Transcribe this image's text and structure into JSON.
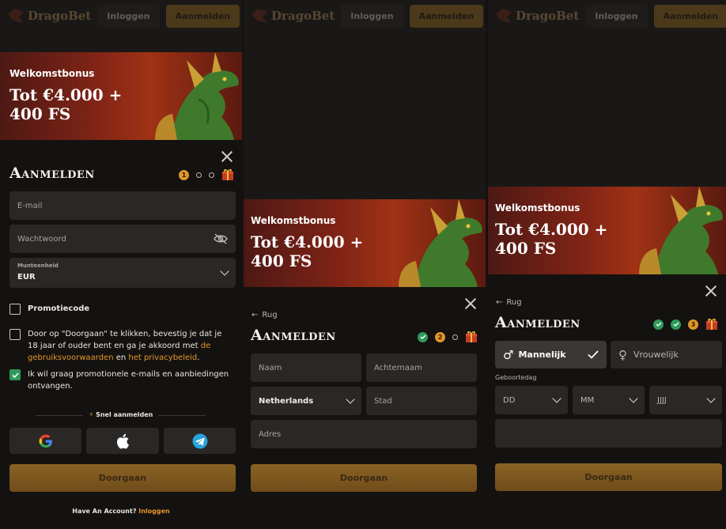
{
  "brand": {
    "logo_text": "DragoBet"
  },
  "topbar": {
    "login_label": "Inloggen",
    "signup_label": "Aanmelden"
  },
  "banner": {
    "subtitle": "Welkomstbonus",
    "headline_line1": "Tot €4.000 +",
    "headline_line2": "400 FS"
  },
  "form_title": "Aanmelden",
  "back_label": "Rug",
  "step1": {
    "current_step": "1",
    "email_placeholder": "E-mail",
    "password_placeholder": "Wachtwoord",
    "currency_label": "Munteenheid",
    "currency_value": "EUR",
    "promo_label": "Promotiecode",
    "terms_text_1": "Door op \"Doorgaan\" te klikken, bevestig je dat je 18 jaar of ouder bent en ga je akkoord met ",
    "terms_link_1": "de gebruiksvoorwaarden",
    "terms_text_2": " en ",
    "terms_link_2": "het privacybeleid",
    "terms_text_3": ".",
    "marketing_label": "Ik wil graag promotionele e-mails en aanbiedingen ontvangen.",
    "quick_signup_label": "Snel aanmelden",
    "continue_label": "Doorgaan",
    "footer_text": "Have An Account?",
    "footer_link": "Inloggen"
  },
  "step2": {
    "current_step": "2",
    "first_name_placeholder": "Naam",
    "last_name_placeholder": "Achternaam",
    "country_value": "Netherlands",
    "city_placeholder": "Stad",
    "address_placeholder": "Adres",
    "continue_label": "Doorgaan"
  },
  "step3": {
    "current_step": "3",
    "male_label": "Mannelijk",
    "female_label": "Vrouwelijk",
    "birthdate_label": "Geboortedag",
    "day_placeholder": "DD",
    "month_placeholder": "MM",
    "year_placeholder": "JJJJ",
    "continue_label": "Doorgaan"
  },
  "colors": {
    "accent": "#e2962a",
    "success": "#2e9a5a",
    "banner_red": "#7e2316",
    "button_gold": "#8a6224"
  }
}
